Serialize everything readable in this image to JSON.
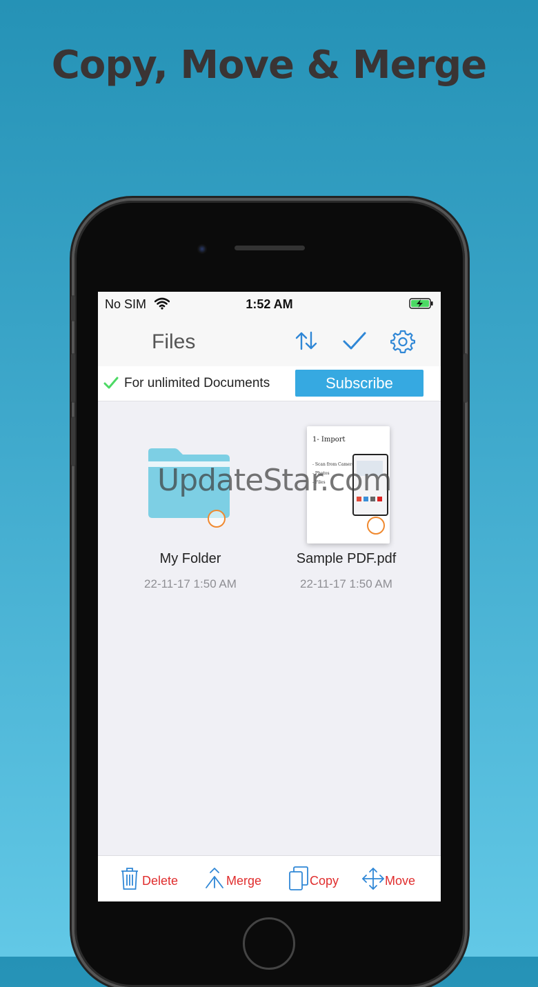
{
  "headline": "Copy, Move & Merge",
  "status_bar": {
    "carrier": "No SIM",
    "time": "1:52 AM"
  },
  "nav": {
    "title": "Files"
  },
  "banner": {
    "text": "For unlimited Documents",
    "button": "Subscribe"
  },
  "items": [
    {
      "name": "My Folder",
      "date": "22-11-17 1:50 AM",
      "kind": "folder-icon"
    },
    {
      "name": "Sample PDF.pdf",
      "date": "22-11-17 1:50 AM",
      "kind": "pdf-thumbnail"
    }
  ],
  "pdf_preview": {
    "heading": "1- Import",
    "lines": [
      "- Scan from Camera",
      "- Photos",
      "- Files"
    ]
  },
  "watermark": "UpdateStar.com",
  "toolbar": {
    "delete": "Delete",
    "merge": "Merge",
    "copy": "Copy",
    "move": "Move"
  },
  "colors": {
    "accent_blue": "#2f87d6",
    "subscribe_bg": "#36a9e1",
    "toolbar_text": "#e02d2d",
    "folder": "#7dcfe4",
    "selection_ring": "#f0892f",
    "check_green": "#4cd964"
  }
}
